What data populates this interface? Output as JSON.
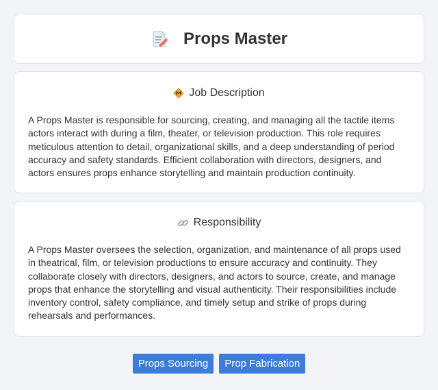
{
  "header": {
    "title": "Props Master",
    "icon": "memo-icon"
  },
  "sections": [
    {
      "heading": "Job Description",
      "icon": "diamond-warning-icon",
      "text": "A Props Master is responsible for sourcing, creating, and managing all the tactile items actors interact with during a film, theater, or television production. This role requires meticulous attention to detail, organizational skills, and a deep understanding of period accuracy and safety standards. Efficient collaboration with directors, designers, and actors ensures props enhance storytelling and maintain production continuity."
    },
    {
      "heading": "Responsibility",
      "icon": "link-icon",
      "text": "A Props Master oversees the selection, organization, and maintenance of all props used in theatrical, film, or television productions to ensure accuracy and continuity. They collaborate closely with directors, designers, and actors to source, create, and manage props that enhance the storytelling and visual authenticity. Their responsibilities include inventory control, safety compliance, and timely setup and strike of props during rehearsals and performances."
    }
  ],
  "tags": [
    "Props Sourcing",
    "Prop Fabrication"
  ],
  "colors": {
    "tag_background": "#3b7dd8",
    "page_background": "#f2f4f7"
  }
}
